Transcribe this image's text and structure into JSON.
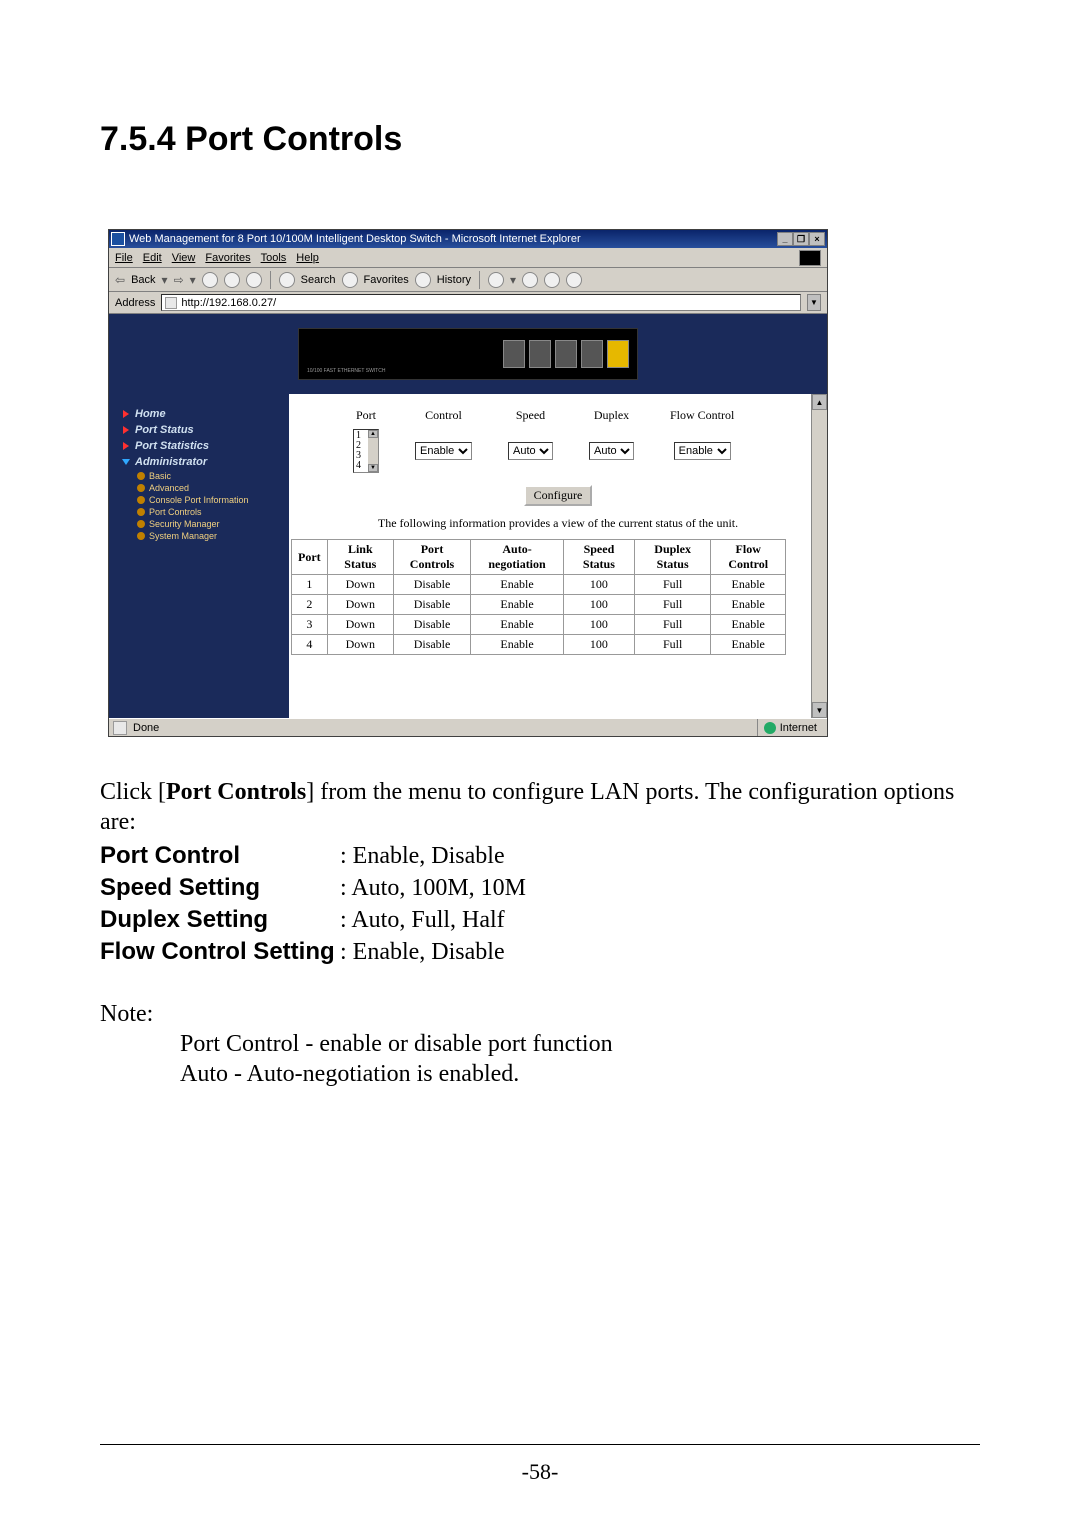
{
  "section_title": "7.5.4 Port Controls",
  "ie": {
    "title": "Web Management for 8 Port 10/100M Intelligent Desktop Switch - Microsoft Internet Explorer",
    "menus": [
      "File",
      "Edit",
      "View",
      "Favorites",
      "Tools",
      "Help"
    ],
    "toolbar_back": "Back",
    "toolbar_search": "Search",
    "toolbar_favorites": "Favorites",
    "toolbar_history": "History",
    "address_label": "Address",
    "address_value": "http://192.168.0.27/",
    "status_done": "Done",
    "status_zone": "Internet"
  },
  "unit_label": "10/100 FAST ETHERNET SWITCH",
  "sidebar": {
    "items": [
      {
        "label": "Home"
      },
      {
        "label": "Port Status"
      },
      {
        "label": "Port Statistics"
      },
      {
        "label": "Administrator"
      }
    ],
    "subitems": [
      {
        "label": "Basic"
      },
      {
        "label": "Advanced"
      },
      {
        "label": "Console Port Information"
      },
      {
        "label": "Port Controls"
      },
      {
        "label": "Security Manager"
      },
      {
        "label": "System Manager"
      }
    ]
  },
  "controls": {
    "headers": {
      "port": "Port",
      "control": "Control",
      "speed": "Speed",
      "duplex": "Duplex",
      "flow": "Flow Control"
    },
    "port_options": [
      "1",
      "2",
      "3",
      "4"
    ],
    "control_value": "Enable",
    "speed_value": "Auto",
    "duplex_value": "Auto",
    "flow_value": "Enable",
    "configure_label": "Configure",
    "info_line": "The following information provides a view of the current status of the unit."
  },
  "status_table": {
    "headers": [
      "Port",
      "Link Status",
      "Port Controls",
      "Auto-negotiation",
      "Speed Status",
      "Duplex Status",
      "Flow Control"
    ],
    "rows": [
      [
        "1",
        "Down",
        "Disable",
        "Enable",
        "100",
        "Full",
        "Enable"
      ],
      [
        "2",
        "Down",
        "Disable",
        "Enable",
        "100",
        "Full",
        "Enable"
      ],
      [
        "3",
        "Down",
        "Disable",
        "Enable",
        "100",
        "Full",
        "Enable"
      ],
      [
        "4",
        "Down",
        "Disable",
        "Enable",
        "100",
        "Full",
        "Enable"
      ]
    ]
  },
  "body": {
    "intro_pre": "Click [",
    "intro_bold": "Port Controls",
    "intro_post": "] from the menu to configure LAN ports. The configuration options are:",
    "settings": [
      {
        "label": "Port Control",
        "value": ": Enable,  Disable"
      },
      {
        "label": "Speed Setting",
        "value": ": Auto, 100M, 10M"
      },
      {
        "label": "Duplex Setting",
        "value": ": Auto, Full, Half"
      },
      {
        "label": "Flow Control Setting",
        "value": ":  Enable,  Disable"
      }
    ],
    "note_label": "Note:",
    "note_lines": [
      "Port Control - enable or disable port function",
      "Auto - Auto-negotiation is enabled."
    ]
  },
  "page_number": "-58-"
}
